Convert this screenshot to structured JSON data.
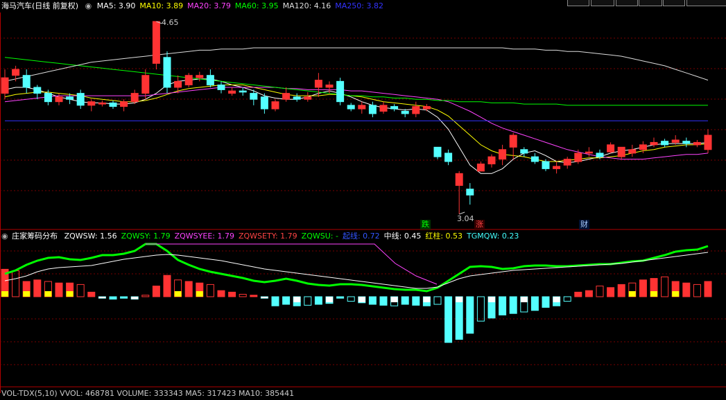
{
  "main_panel": {
    "title": "海马汽车(日线 前复权)",
    "indicators": [
      {
        "label": "MA5: 3.90",
        "color": "#ffffff"
      },
      {
        "label": "MA10: 3.89",
        "color": "#ffff00"
      },
      {
        "label": "MA20: 3.79",
        "color": "#ff44ff"
      },
      {
        "label": "MA60: 3.95",
        "color": "#00ff00"
      },
      {
        "label": "MA120: 4.16",
        "color": "#dddddd"
      },
      {
        "label": "MA250: 3.82",
        "color": "#3333ff"
      }
    ],
    "high_label": "4.65",
    "low_label": "3.04",
    "markers": [
      {
        "text": "跌",
        "color": "#00ff00",
        "bg": "#003300"
      },
      {
        "text": "涨",
        "color": "#ff4444",
        "bg": "#330000"
      },
      {
        "text": "财",
        "color": "#aaccff",
        "bg": "#001133"
      }
    ]
  },
  "sub_panel": {
    "title": "庄家筹码分布",
    "indicators": [
      {
        "label": "ZQWSW: 1.56",
        "color": "#ffffff"
      },
      {
        "label": "ZQWSY: 1.79",
        "color": "#00ff00"
      },
      {
        "label": "ZQWSYEE: 1.79",
        "color": "#ff44ff"
      },
      {
        "label": "ZQWSETY: 1.79",
        "color": "#ff4444"
      },
      {
        "label": "ZQWSU: -",
        "color": "#00ff00"
      },
      {
        "label": "起线: 0.72",
        "color": "#3355ff"
      },
      {
        "label": "中线: 0.45",
        "color": "#ffffff"
      },
      {
        "label": "红柱: 0.53",
        "color": "#ffff00"
      },
      {
        "label": "TGMQW: 0.23",
        "color": "#44ffff"
      }
    ]
  },
  "vol_panel": {
    "header": "VOL-TDX(5,10)  VVOL: 468781  VOLUME: 333343  MA5: 317423  MA10: 385441"
  },
  "colors": {
    "up": "#ff3333",
    "down": "#54ffff",
    "grid": "#7a0000"
  },
  "chart_data": {
    "type": "candlestick",
    "price_range": [
      3.04,
      4.65
    ],
    "candles": [
      [
        4.05,
        4.18,
        4.0,
        4.25
      ],
      [
        4.2,
        4.25,
        4.15,
        4.28
      ],
      [
        4.2,
        4.1,
        4.05,
        4.25
      ],
      [
        4.1,
        4.05,
        4.0,
        4.12
      ],
      [
        4.05,
        3.98,
        3.95,
        4.08
      ],
      [
        3.98,
        4.02,
        3.95,
        4.05
      ],
      [
        4.02,
        4.0,
        3.96,
        4.05
      ],
      [
        4.05,
        3.95,
        3.92,
        4.08
      ],
      [
        3.95,
        3.98,
        3.9,
        4.0
      ],
      [
        3.96,
        3.97,
        3.94,
        3.99
      ],
      [
        3.97,
        3.94,
        3.92,
        3.99
      ],
      [
        3.94,
        3.98,
        3.9,
        4.0
      ],
      [
        3.98,
        4.05,
        3.96,
        4.08
      ],
      [
        4.05,
        4.2,
        4.0,
        4.25
      ],
      [
        4.3,
        4.65,
        4.25,
        4.65
      ],
      [
        4.35,
        4.1,
        4.05,
        4.4
      ],
      [
        4.1,
        4.15,
        4.05,
        4.2
      ],
      [
        4.12,
        4.2,
        4.1,
        4.22
      ],
      [
        4.18,
        4.2,
        4.15,
        4.23
      ],
      [
        4.2,
        4.12,
        4.1,
        4.25
      ],
      [
        4.12,
        4.08,
        4.05,
        4.15
      ],
      [
        4.05,
        4.07,
        4.03,
        4.1
      ],
      [
        4.07,
        4.06,
        4.03,
        4.1
      ],
      [
        4.05,
        4.0,
        3.95,
        4.08
      ],
      [
        4.02,
        3.92,
        3.88,
        4.05
      ],
      [
        3.92,
        3.98,
        3.9,
        4.0
      ],
      [
        4.0,
        4.05,
        3.98,
        4.1
      ],
      [
        4.02,
        4.0,
        3.98,
        4.05
      ],
      [
        4.0,
        4.02,
        3.98,
        4.06
      ],
      [
        4.1,
        4.16,
        4.02,
        4.22
      ],
      [
        4.1,
        4.12,
        4.05,
        4.15
      ],
      [
        4.15,
        3.98,
        3.95,
        4.18
      ],
      [
        3.95,
        3.92,
        3.9,
        3.97
      ],
      [
        3.92,
        3.95,
        3.88,
        3.98
      ],
      [
        3.95,
        3.88,
        3.85,
        3.98
      ],
      [
        3.9,
        3.95,
        3.88,
        3.98
      ],
      [
        3.94,
        3.92,
        3.9,
        3.96
      ],
      [
        3.9,
        3.88,
        3.85,
        3.92
      ],
      [
        3.88,
        3.94,
        3.85,
        3.98
      ],
      [
        3.92,
        3.94,
        3.9,
        3.96
      ],
      [
        3.6,
        3.52,
        3.5,
        3.6
      ],
      [
        3.55,
        3.48,
        3.45,
        3.58
      ],
      [
        3.28,
        3.38,
        3.04,
        3.4
      ],
      [
        3.25,
        3.2,
        3.12,
        3.3
      ],
      [
        3.4,
        3.46,
        3.4,
        3.48
      ],
      [
        3.46,
        3.52,
        3.43,
        3.54
      ],
      [
        3.5,
        3.58,
        3.45,
        3.62
      ],
      [
        3.6,
        3.7,
        3.5,
        3.72
      ],
      [
        3.58,
        3.55,
        3.52,
        3.6
      ],
      [
        3.52,
        3.48,
        3.46,
        3.55
      ],
      [
        3.48,
        3.42,
        3.4,
        3.5
      ],
      [
        3.42,
        3.44,
        3.38,
        3.48
      ],
      [
        3.45,
        3.5,
        3.42,
        3.52
      ],
      [
        3.48,
        3.55,
        3.46,
        3.58
      ],
      [
        3.55,
        3.56,
        3.52,
        3.6
      ],
      [
        3.55,
        3.52,
        3.5,
        3.58
      ],
      [
        3.56,
        3.62,
        3.55,
        3.64
      ],
      [
        3.52,
        3.6,
        3.5,
        3.6
      ],
      [
        3.55,
        3.58,
        3.52,
        3.62
      ],
      [
        3.58,
        3.62,
        3.55,
        3.65
      ],
      [
        3.62,
        3.64,
        3.6,
        3.68
      ],
      [
        3.65,
        3.62,
        3.6,
        3.67
      ],
      [
        3.64,
        3.66,
        3.62,
        3.7
      ],
      [
        3.65,
        3.63,
        3.6,
        3.68
      ],
      [
        3.62,
        3.64,
        3.6,
        3.66
      ],
      [
        3.58,
        3.7,
        3.55,
        3.75
      ]
    ],
    "ma_lines": {
      "MA5": [
        4.08,
        4.1,
        4.1,
        4.08,
        4.05,
        4.02,
        4.0,
        3.98,
        3.97,
        3.97,
        3.96,
        3.96,
        3.97,
        4.0,
        4.05,
        4.12,
        4.15,
        4.16,
        4.17,
        4.17,
        4.15,
        4.12,
        4.1,
        4.07,
        4.03,
        4.01,
        4.0,
        4.0,
        4.02,
        4.05,
        4.07,
        4.05,
        4.02,
        3.98,
        3.95,
        3.93,
        3.92,
        3.91,
        3.92,
        3.91,
        3.85,
        3.75,
        3.6,
        3.45,
        3.38,
        3.38,
        3.42,
        3.5,
        3.55,
        3.57,
        3.53,
        3.48,
        3.47,
        3.48,
        3.5,
        3.52,
        3.55,
        3.57,
        3.58,
        3.6,
        3.62,
        3.63,
        3.63,
        3.63,
        3.63,
        3.64
      ],
      "MA10": [
        4.02,
        4.04,
        4.05,
        4.06,
        4.06,
        4.05,
        4.04,
        4.03,
        4.01,
        4.0,
        3.99,
        3.98,
        3.98,
        3.99,
        4.01,
        4.04,
        4.07,
        4.09,
        4.1,
        4.11,
        4.12,
        4.12,
        4.12,
        4.1,
        4.08,
        4.06,
        4.04,
        4.03,
        4.03,
        4.03,
        4.04,
        4.04,
        4.03,
        4.02,
        4.0,
        3.98,
        3.97,
        3.96,
        3.95,
        3.94,
        3.91,
        3.86,
        3.78,
        3.7,
        3.62,
        3.57,
        3.54,
        3.53,
        3.52,
        3.5,
        3.48,
        3.48,
        3.49,
        3.5,
        3.51,
        3.51,
        3.52,
        3.53,
        3.55,
        3.57,
        3.58,
        3.6,
        3.61,
        3.62,
        3.62,
        3.63
      ],
      "MA20": [
        3.98,
        3.99,
        4.0,
        4.01,
        4.02,
        4.03,
        4.03,
        4.03,
        4.03,
        4.03,
        4.03,
        4.03,
        4.03,
        4.03,
        4.04,
        4.05,
        4.06,
        4.07,
        4.08,
        4.09,
        4.1,
        4.1,
        4.1,
        4.1,
        4.1,
        4.1,
        4.09,
        4.09,
        4.08,
        4.08,
        4.08,
        4.08,
        4.07,
        4.07,
        4.06,
        4.05,
        4.04,
        4.03,
        4.02,
        4.01,
        4.0,
        3.98,
        3.94,
        3.9,
        3.85,
        3.8,
        3.76,
        3.73,
        3.7,
        3.67,
        3.64,
        3.61,
        3.58,
        3.56,
        3.54,
        3.52,
        3.51,
        3.5,
        3.5,
        3.5,
        3.51,
        3.52,
        3.53,
        3.54,
        3.54,
        3.55
      ],
      "MA60": [
        4.35,
        4.34,
        4.33,
        4.32,
        4.31,
        4.3,
        4.29,
        4.28,
        4.27,
        4.26,
        4.25,
        4.24,
        4.23,
        4.22,
        4.21,
        4.2,
        4.19,
        4.18,
        4.17,
        4.16,
        4.15,
        4.14,
        4.13,
        4.12,
        4.11,
        4.1,
        4.09,
        4.08,
        4.07,
        4.06,
        4.05,
        4.04,
        4.03,
        4.03,
        4.02,
        4.02,
        4.01,
        4.01,
        4.0,
        4.0,
        3.99,
        3.99,
        3.98,
        3.98,
        3.98,
        3.97,
        3.97,
        3.97,
        3.96,
        3.96,
        3.96,
        3.96,
        3.95,
        3.95,
        3.95,
        3.95,
        3.95,
        3.95,
        3.95,
        3.95,
        3.95,
        3.95,
        3.95,
        3.95,
        3.95,
        3.95
      ],
      "MA120": [
        4.15,
        4.17,
        4.19,
        4.21,
        4.23,
        4.25,
        4.27,
        4.29,
        4.31,
        4.32,
        4.33,
        4.34,
        4.35,
        4.36,
        4.37,
        4.38,
        4.39,
        4.4,
        4.41,
        4.41,
        4.42,
        4.42,
        4.42,
        4.43,
        4.43,
        4.43,
        4.43,
        4.43,
        4.43,
        4.43,
        4.43,
        4.43,
        4.43,
        4.43,
        4.43,
        4.43,
        4.43,
        4.43,
        4.43,
        4.43,
        4.43,
        4.43,
        4.43,
        4.43,
        4.43,
        4.43,
        4.43,
        4.42,
        4.42,
        4.42,
        4.41,
        4.41,
        4.4,
        4.4,
        4.39,
        4.38,
        4.37,
        4.36,
        4.34,
        4.32,
        4.3,
        4.28,
        4.25,
        4.22,
        4.19,
        4.16
      ],
      "MA250": [
        3.82,
        3.82,
        3.82,
        3.82,
        3.82,
        3.82,
        3.82,
        3.82,
        3.82,
        3.82,
        3.82,
        3.82,
        3.82,
        3.82,
        3.82,
        3.82,
        3.82,
        3.82,
        3.82,
        3.82,
        3.82,
        3.82,
        3.82,
        3.82,
        3.82,
        3.82,
        3.82,
        3.82,
        3.82,
        3.82,
        3.82,
        3.82,
        3.82,
        3.82,
        3.82,
        3.82,
        3.82,
        3.82,
        3.82,
        3.82,
        3.82,
        3.82,
        3.82,
        3.82,
        3.82,
        3.82,
        3.82,
        3.82,
        3.82,
        3.82,
        3.82,
        3.82,
        3.82,
        3.82,
        3.82,
        3.82,
        3.82,
        3.82,
        3.82,
        3.82,
        3.82,
        3.82,
        3.82,
        3.82,
        3.82,
        3.82
      ]
    },
    "sub_bars": [
      0.9,
      0.85,
      0.5,
      0.55,
      0.5,
      0.45,
      0.45,
      0.4,
      0.15,
      -0.05,
      -0.08,
      -0.05,
      -0.08,
      0.05,
      0.35,
      0.7,
      0.55,
      0.5,
      0.45,
      0.4,
      0.2,
      0.15,
      0.08,
      0.05,
      -0.05,
      -0.3,
      -0.25,
      -0.3,
      -0.28,
      -0.25,
      -0.22,
      -0.05,
      -0.15,
      -0.2,
      -0.25,
      -0.28,
      -0.3,
      -0.25,
      -0.28,
      -0.3,
      -0.25,
      -1.5,
      -1.4,
      -1.2,
      -0.8,
      -0.7,
      -0.6,
      -0.55,
      -0.5,
      -0.45,
      -0.35,
      -0.3,
      -0.15,
      0.15,
      0.2,
      0.35,
      0.3,
      0.4,
      0.45,
      0.55,
      0.6,
      0.65,
      0.5,
      0.45,
      0.4,
      0.5
    ]
  }
}
